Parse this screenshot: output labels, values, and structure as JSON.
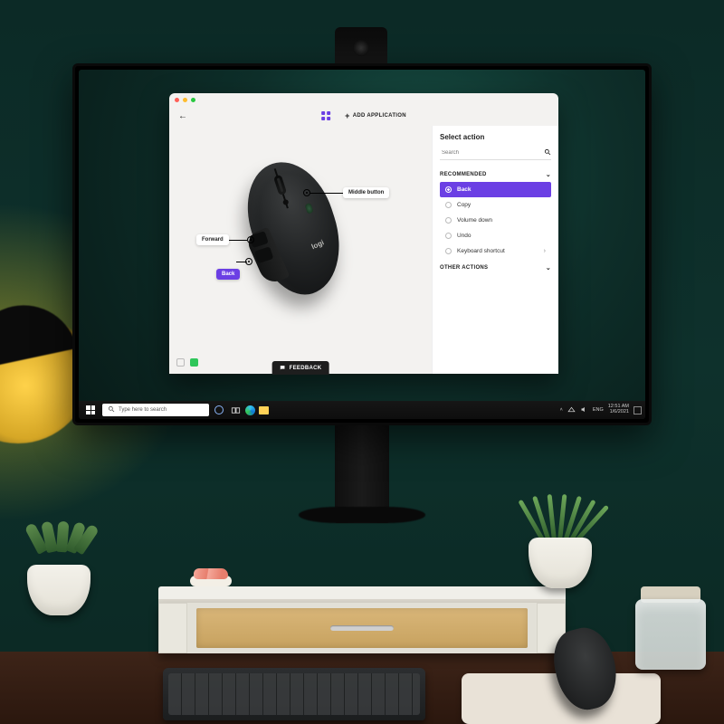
{
  "app": {
    "top": {
      "add_application": "ADD APPLICATION"
    },
    "callouts": {
      "middle": "Middle button",
      "forward": "Forward",
      "back": "Back"
    },
    "mouse_brand": "logi",
    "feedback": "FEEDBACK",
    "panel": {
      "title": "Select action",
      "search_placeholder": "Search",
      "sections": {
        "recommended": "RECOMMENDED",
        "other": "OTHER ACTIONS"
      },
      "options": {
        "back": "Back",
        "copy": "Copy",
        "volume_down": "Volume down",
        "undo": "Undo",
        "keyboard_shortcut": "Keyboard shortcut"
      }
    }
  },
  "taskbar": {
    "search_placeholder": "Type here to search",
    "lang": "ENG",
    "time": "12:51 AM",
    "date": "1/6/2021"
  }
}
